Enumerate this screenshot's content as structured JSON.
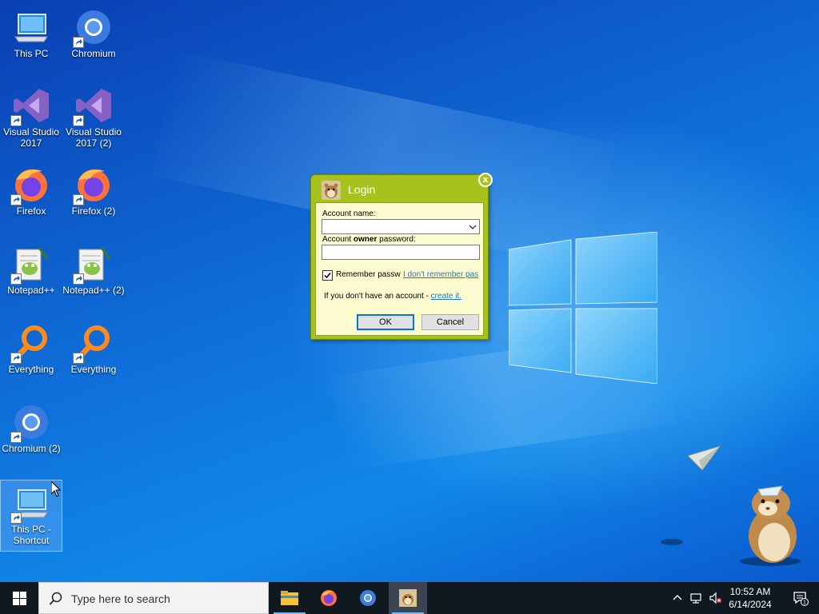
{
  "desktop": {
    "icons": [
      {
        "label": "This PC",
        "icon": "computer-icon"
      },
      {
        "label": "Chromium",
        "icon": "chromium-icon"
      },
      {
        "label": "Visual Studio 2017",
        "icon": "visual-studio-icon"
      },
      {
        "label": "Visual Studio 2017 (2)",
        "icon": "visual-studio-icon"
      },
      {
        "label": "Firefox",
        "icon": "firefox-icon"
      },
      {
        "label": "Firefox (2)",
        "icon": "firefox-icon"
      },
      {
        "label": "Notepad++",
        "icon": "notepadpp-icon"
      },
      {
        "label": "Notepad++ (2)",
        "icon": "notepadpp-icon"
      },
      {
        "label": "Everything",
        "icon": "everything-icon"
      },
      {
        "label": "Everything",
        "icon": "everything-icon"
      },
      {
        "label": "Chromium (2)",
        "icon": "chromium-icon"
      },
      {
        "label": "This PC - Shortcut",
        "icon": "computer-icon"
      }
    ]
  },
  "login": {
    "title": "Login",
    "close": "x",
    "account_label": "Account name:",
    "account_value": "",
    "password_label_prefix": "Account ",
    "password_label_bold": "owner",
    "password_label_suffix": " password:",
    "password_value": "",
    "remember_label": "Remember passw",
    "remember_checked": true,
    "forgot_link": "I don't remember pas",
    "no_account_text": "If you don't have an account - ",
    "create_link": "create it.",
    "ok_label": "OK",
    "cancel_label": "Cancel",
    "accent_color": "#a7c21c",
    "body_color": "#fdfcd1"
  },
  "taskbar": {
    "search_placeholder": "Type here to search",
    "apps": [
      "file-explorer-icon",
      "firefox-icon",
      "chromium-icon",
      "hamster-app-icon"
    ],
    "time": "10:52 AM",
    "date": "6/14/2024",
    "notifications_count": "1"
  }
}
